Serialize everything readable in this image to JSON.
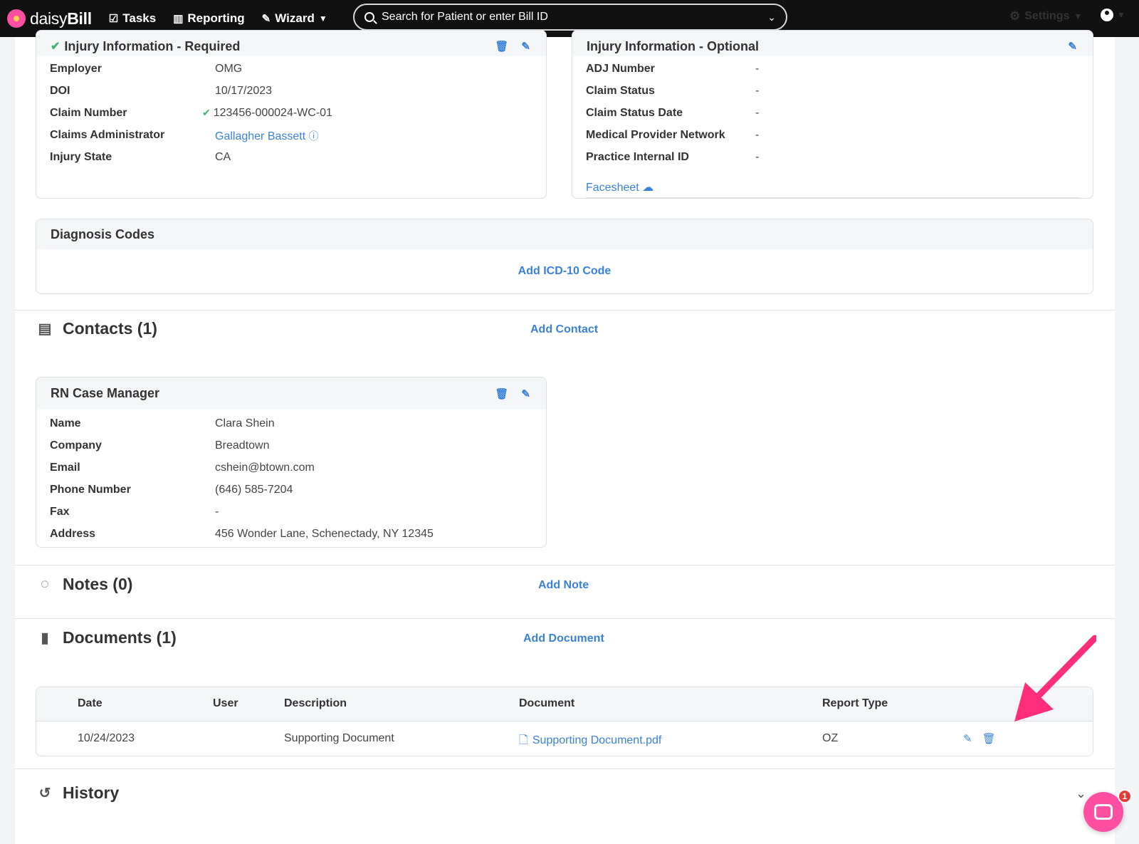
{
  "nav": {
    "brand": "daisyBill",
    "brand_light": "daisy",
    "brand_bold": "Bill",
    "tasks": "Tasks",
    "reporting": "Reporting",
    "wizard": "Wizard",
    "search_placeholder": "Search for Patient or enter Bill ID",
    "settings": "Settings"
  },
  "injury_required": {
    "title": "Injury Information - Required",
    "rows": [
      {
        "label": "Employer",
        "value": "OMG"
      },
      {
        "label": "DOI",
        "value": "10/17/2023"
      },
      {
        "label": "Claim Number",
        "value": "123456-000024-WC-01"
      },
      {
        "label": "Claims Administrator",
        "value": "Gallagher Bassett"
      },
      {
        "label": "Injury State",
        "value": "CA"
      }
    ]
  },
  "injury_optional": {
    "title": "Injury Information - Optional",
    "rows": [
      {
        "label": "ADJ Number",
        "value": "-"
      },
      {
        "label": "Claim Status",
        "value": "-"
      },
      {
        "label": "Claim Status Date",
        "value": "-"
      },
      {
        "label": "Medical Provider Network",
        "value": "-"
      },
      {
        "label": "Practice Internal ID",
        "value": "-"
      }
    ],
    "facesheet": "Facesheet"
  },
  "diagnosis": {
    "title": "Diagnosis Codes",
    "add": "Add ICD-10 Code"
  },
  "contacts": {
    "title": "Contacts (1)",
    "add": "Add Contact",
    "card_title": "RN Case Manager",
    "rows": [
      {
        "label": "Name",
        "value": "Clara Shein"
      },
      {
        "label": "Company",
        "value": "Breadtown"
      },
      {
        "label": "Email",
        "value": "cshein@btown.com"
      },
      {
        "label": "Phone Number",
        "value": "(646) 585-7204"
      },
      {
        "label": "Fax",
        "value": "-"
      },
      {
        "label": "Address",
        "value": "456 Wonder Lane, Schenectady, NY 12345"
      }
    ]
  },
  "notes": {
    "title": "Notes (0)",
    "add": "Add Note"
  },
  "documents": {
    "title": "Documents (1)",
    "add": "Add Document",
    "columns": [
      "Date",
      "User",
      "Description",
      "Document",
      "Report Type"
    ],
    "rows": [
      {
        "date": "10/24/2023",
        "user": "",
        "description": "Supporting Document",
        "document": "Supporting Document.pdf",
        "report_type": "OZ"
      }
    ]
  },
  "history": {
    "title": "History"
  },
  "chat": {
    "badge": "1"
  },
  "colors": {
    "accent": "#3b82d6",
    "brand_pink": "#ff4fa3",
    "success": "#3cb371",
    "annotation_arrow": "#ff2d7a"
  }
}
